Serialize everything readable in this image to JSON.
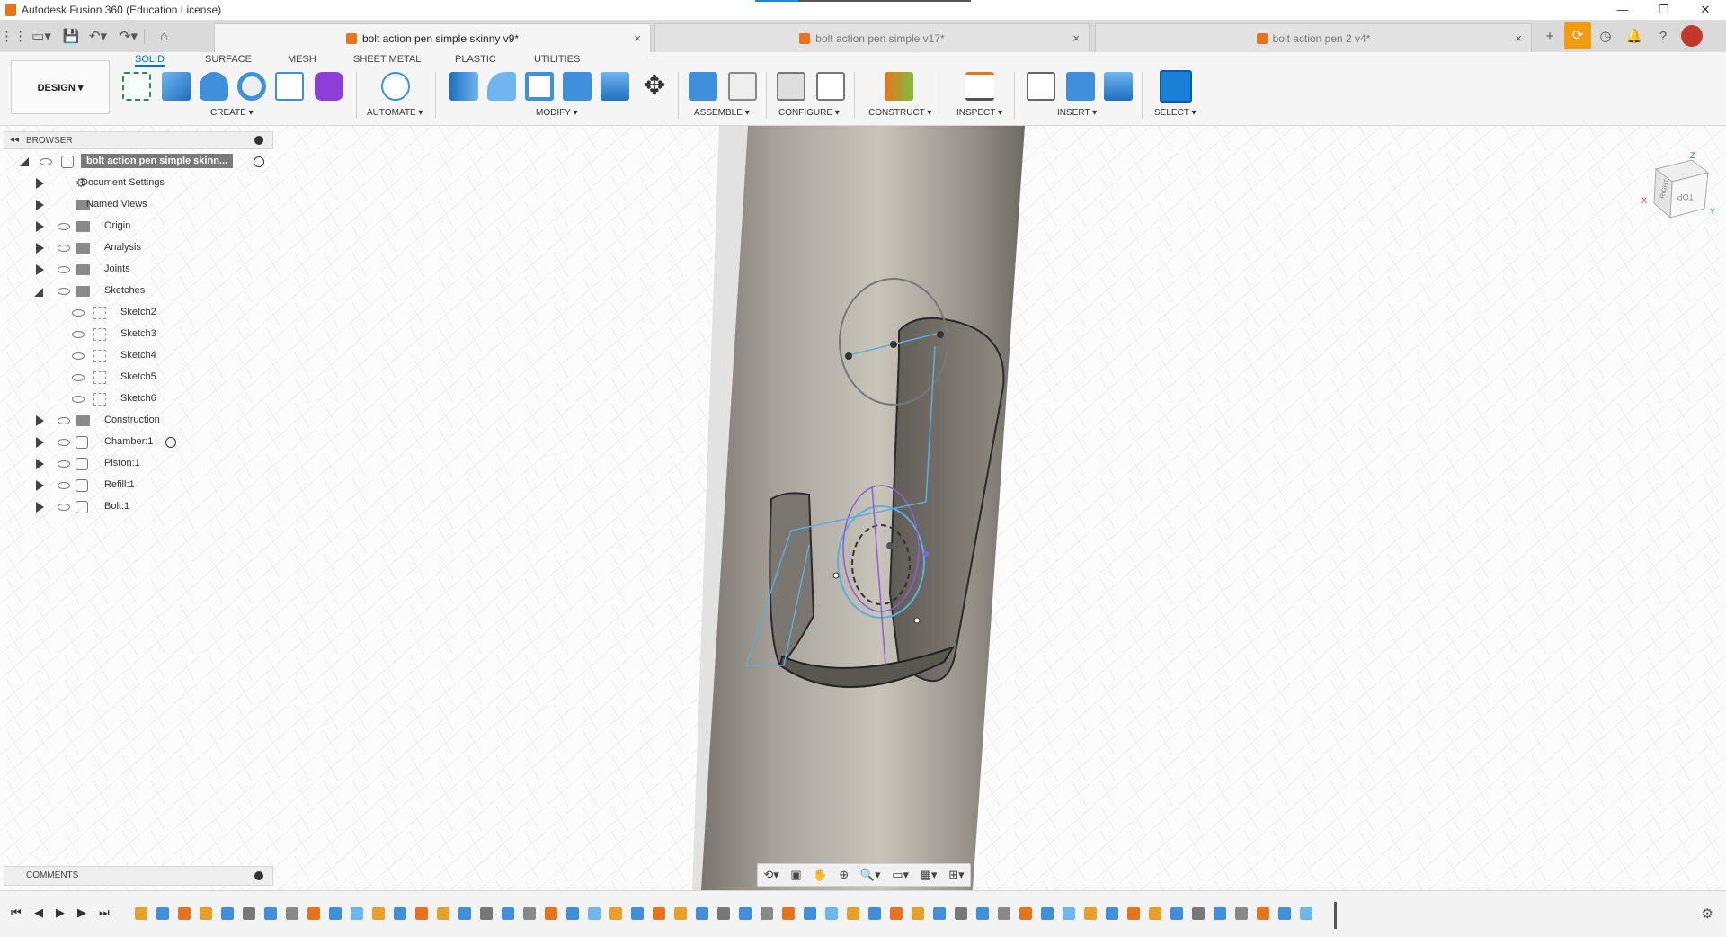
{
  "window": {
    "title": "Autodesk Fusion 360 (Education License)",
    "controls": [
      "—",
      "❐",
      "✕"
    ]
  },
  "quick_access": {
    "icons": [
      "grid-icon",
      "file-icon",
      "save-icon",
      "undo-icon",
      "redo-icon",
      "home-icon"
    ],
    "glyphs": [
      "⋮⋮",
      "▭▾",
      "💾",
      "↶▾",
      "↷▾",
      "⌂"
    ]
  },
  "tabs": [
    {
      "label": "bolt action pen simple skinny v9*",
      "active": true
    },
    {
      "label": "bolt action pen simple v17*",
      "active": false
    },
    {
      "label": "bolt action pen 2 v4*",
      "active": false
    }
  ],
  "tab_close": "×",
  "right_icons": {
    "add": "+",
    "clock": "◷",
    "bell": "🔔",
    "help": "?"
  },
  "ribbon": {
    "workspace": "DESIGN ▾",
    "tabs": [
      "SOLID",
      "SURFACE",
      "MESH",
      "SHEET METAL",
      "PLASTIC",
      "UTILITIES"
    ],
    "active_tab": "SOLID",
    "groups": [
      "CREATE ▾",
      "AUTOMATE ▾",
      "MODIFY ▾",
      "ASSEMBLE ▾",
      "CONFIGURE ▾",
      "CONSTRUCT ▾",
      "INSPECT ▾",
      "INSERT ▾",
      "SELECT ▾"
    ]
  },
  "browser": {
    "title": "BROWSER",
    "collapse": "◂◂",
    "root": "bolt action pen simple skinn...",
    "items": [
      {
        "label": "Document Settings",
        "icon": "gear-icon",
        "expandable": true
      },
      {
        "label": "Named Views",
        "icon": "folder-icon",
        "expandable": true
      },
      {
        "label": "Origin",
        "icon": "folder-icon",
        "expandable": true
      },
      {
        "label": "Analysis",
        "icon": "folder-icon",
        "expandable": true
      },
      {
        "label": "Joints",
        "icon": "folder-icon",
        "expandable": true
      },
      {
        "label": "Sketches",
        "icon": "folder-icon",
        "expandable": true,
        "expanded": true
      },
      {
        "label": "Sketch2",
        "icon": "sketch-icon",
        "child": true
      },
      {
        "label": "Sketch3",
        "icon": "sketch-icon",
        "child": true
      },
      {
        "label": "Sketch4",
        "icon": "sketch-icon",
        "child": true
      },
      {
        "label": "Sketch5",
        "icon": "sketch-icon",
        "child": true
      },
      {
        "label": "Sketch6",
        "icon": "sketch-icon",
        "child": true
      },
      {
        "label": "Construction",
        "icon": "folder-icon",
        "expandable": true
      },
      {
        "label": "Chamber:1",
        "icon": "component-icon",
        "expandable": true
      },
      {
        "label": "Piston:1",
        "icon": "component-icon",
        "expandable": true
      },
      {
        "label": "Refill:1",
        "icon": "component-icon",
        "expandable": true
      },
      {
        "label": "Bolt:1",
        "icon": "component-icon",
        "expandable": true
      }
    ]
  },
  "comments": {
    "title": "COMMENTS"
  },
  "viewcube": {
    "top": "TOP",
    "right": "RIGHT",
    "x": "X",
    "y": "Y",
    "z": "Z"
  },
  "nav_bar": {
    "icons": [
      "orbit-icon",
      "look-icon",
      "pan-icon",
      "zoom-icon",
      "fit-icon",
      "display-icon",
      "grid-icon",
      "viewports-icon"
    ],
    "glyphs": [
      "⟲▾",
      "▣",
      "✋",
      "⊕",
      "🔍▾",
      "▭▾",
      "▦▾",
      "⊞▾"
    ]
  },
  "timeline": {
    "controls": [
      "⏮",
      "◀",
      "▶",
      "▶",
      "⏭"
    ],
    "settings": "⚙"
  },
  "colors": {
    "accent": "#0a6fcc",
    "brand": "#e8731c",
    "body_metal": "#a09a90",
    "sketch": "#5aaee0"
  }
}
